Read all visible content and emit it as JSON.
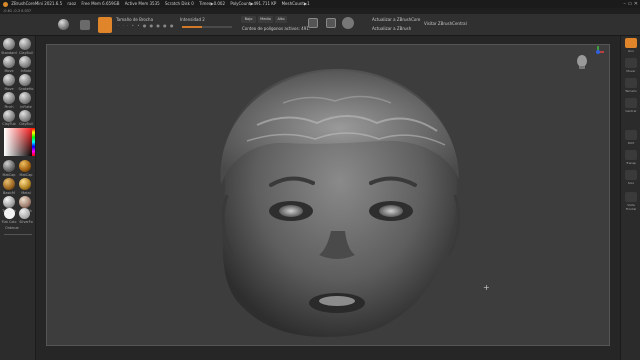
{
  "titlebar": {
    "app": "ZBrushCoreMini 2021.6.5",
    "items": [
      "raoz",
      "Free Mem 6.659GB",
      "Active Mem 3535",
      "Scratch Disk 0",
      "Timer▶0.002",
      "PolyCount▶491.711 KP",
      "MeshCount▶1"
    ]
  },
  "subbar": {
    "text": "-0.61  -0.3  0.037"
  },
  "toolbar": {
    "tamano_label": "Tamaño de Brocha",
    "intensidad_label": "Intensidad 2",
    "bajo": "Bajo",
    "medio": "Medio",
    "alto": "Alto",
    "poligonos_label": "Conteo de polígonos activos: 491.",
    "actualizar_core": "Actualizar a ZBrushCore",
    "actualizar_zbrush": "Actualizar a ZBrush",
    "visitar": "Visitar ZBrushCentral"
  },
  "leftpanel": {
    "brushes": [
      "Standard",
      "ClayBuil",
      "Move",
      "Inflate",
      "Move",
      "SnakeHo",
      "Pinch",
      "InFlate",
      "ClayTub",
      "ClayBuil",
      "ClayBuil",
      "ClayBuil"
    ],
    "materials": [
      "MatCap",
      "MatCap",
      "BasicM",
      "Metal",
      "ToyPlast",
      "SkinSh"
    ],
    "swatches": [
      "Flat Colo",
      "SilverFo"
    ],
    "ordenar": "Ordenar"
  },
  "rightpanel": {
    "items": [
      "Giro",
      "Mover",
      "Tamaño",
      "Centrar",
      "Polif",
      "Transp",
      "Solo",
      "Vista Frontal"
    ]
  },
  "colors": {
    "accent": "#e0852a",
    "viewport_bg": "#3d3d3d",
    "panel_bg": "#2c2c2c"
  }
}
